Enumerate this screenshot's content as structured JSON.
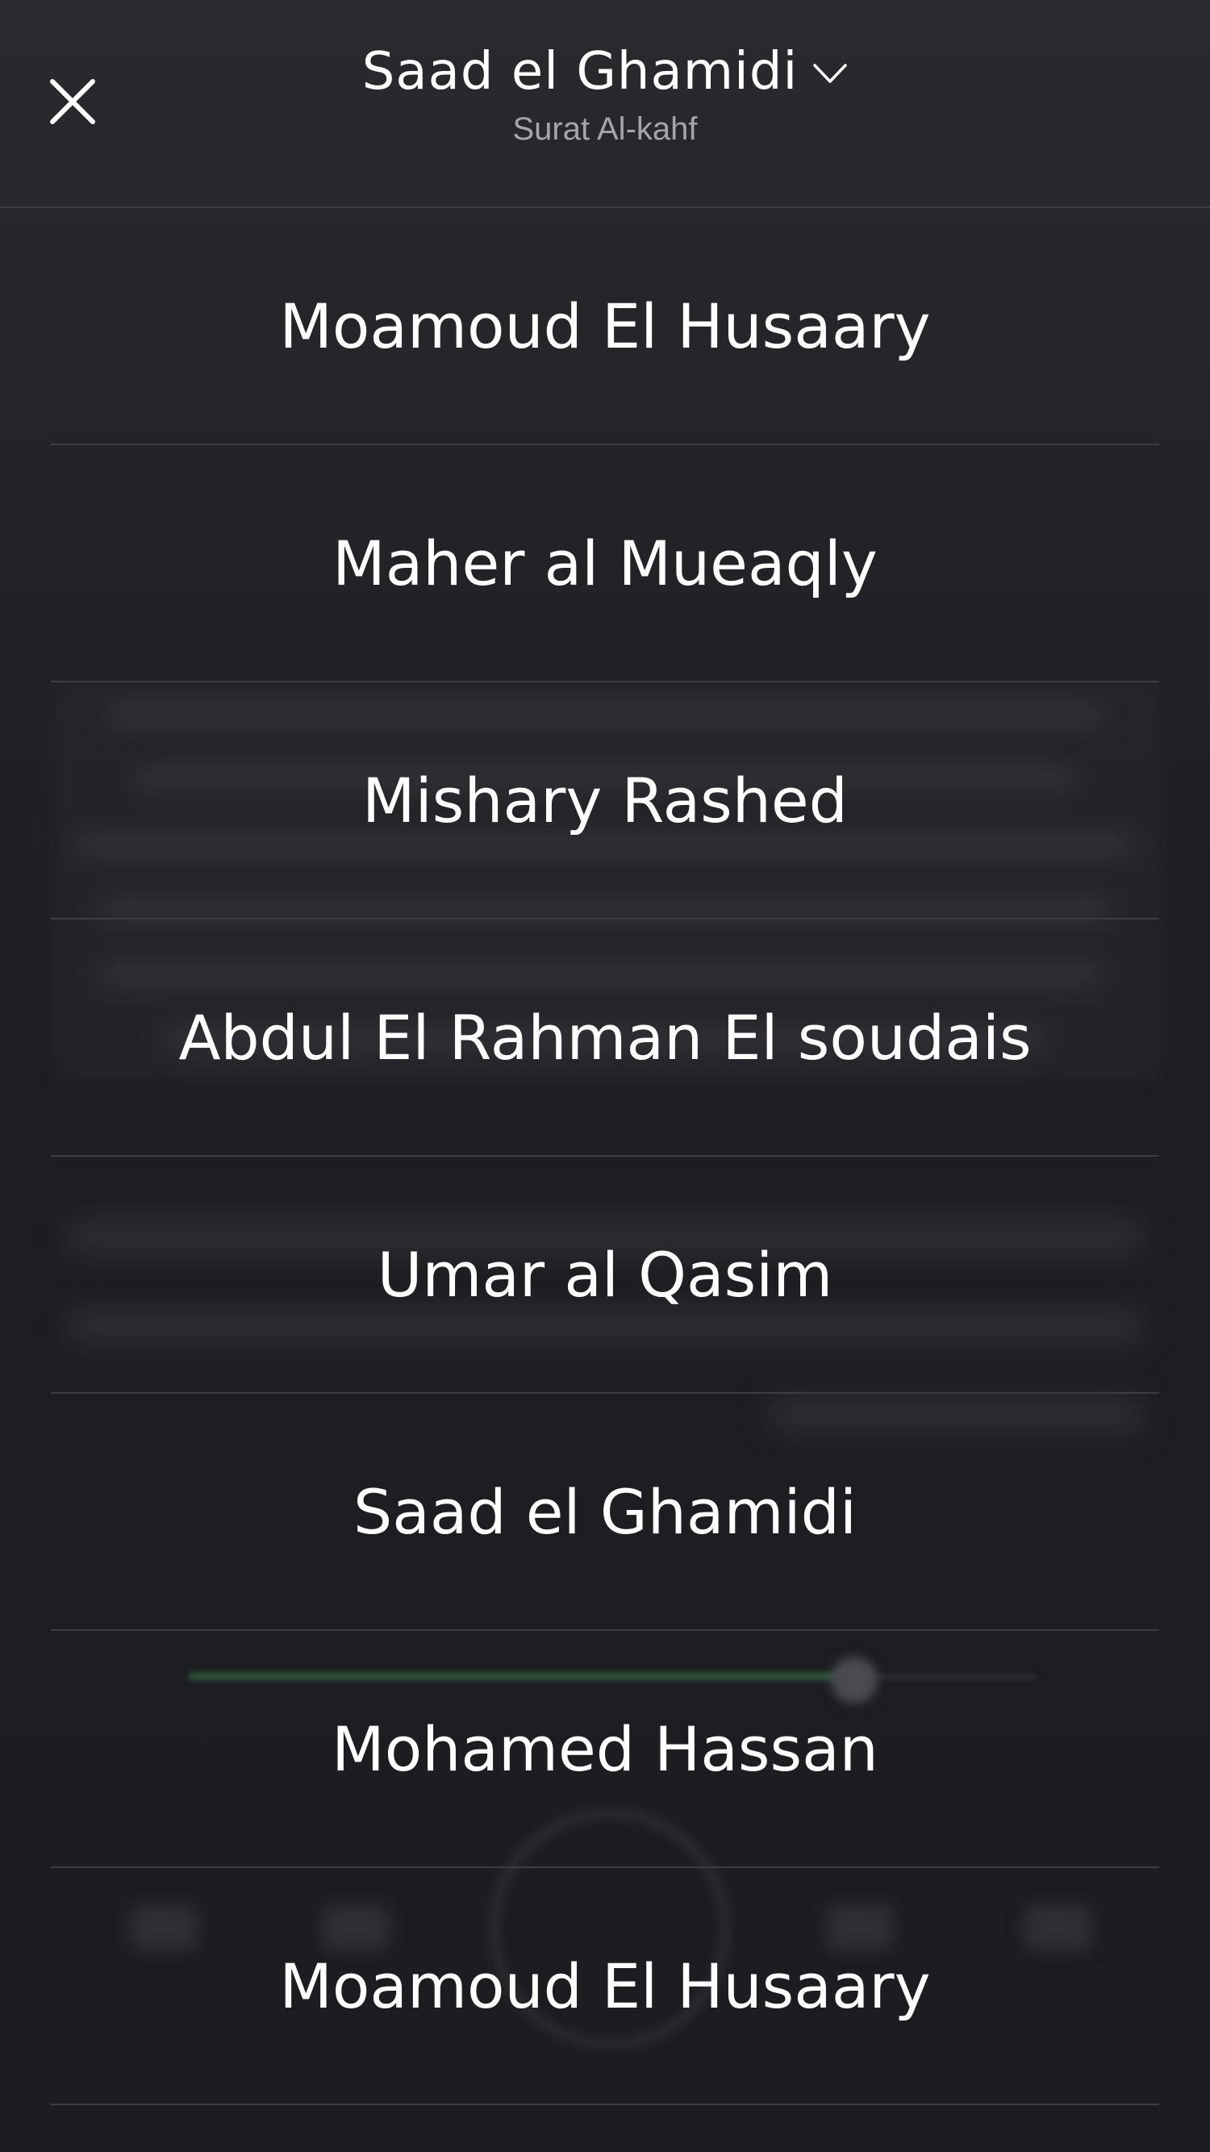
{
  "header": {
    "title": "Saad el Ghamidi",
    "subtitle": "Surat Al-kahf",
    "close_icon": "close-icon",
    "dropdown_icon": "chevron-down-icon"
  },
  "reciters": [
    {
      "label": "Moamoud El Husaary"
    },
    {
      "label": "Maher al Mueaqly"
    },
    {
      "label": "Mishary Rashed"
    },
    {
      "label": "Abdul El Rahman El soudais"
    },
    {
      "label": "Umar al Qasim"
    },
    {
      "label": "Saad el Ghamidi"
    },
    {
      "label": "Mohamed Hassan"
    },
    {
      "label": "Moamoud El Husaary"
    }
  ],
  "colors": {
    "background": "#1f2024",
    "text": "#ffffff",
    "subtitle": "#a5a6aa",
    "divider": "#3c3d42"
  }
}
